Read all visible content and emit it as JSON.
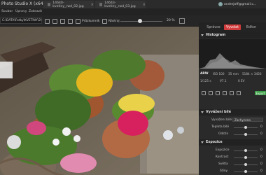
{
  "app": {
    "title": "Photo Studio X (x64)"
  },
  "tabs": [
    {
      "label": "14640-kvetiny_rwd_02.jpg"
    },
    {
      "label": "14643-kvetiny_rwd_03.jpg"
    }
  ],
  "user": {
    "email": "ondrejoff@gmail.c..."
  },
  "menu": [
    {
      "label": "Soubor"
    },
    {
      "label": "Úpravy"
    },
    {
      "label": "Zobrazit"
    }
  ],
  "toolbar": {
    "path": "C:\\DATA\\Fotky\\KVETINY\\2017",
    "browse_label": "Průzkumník",
    "new_label": "Nástroj",
    "zoom": "20 %"
  },
  "modes": [
    {
      "label": "Správce"
    },
    {
      "label": "Vyvolat"
    },
    {
      "label": "Editor"
    }
  ],
  "panel": {
    "histogram_title": "Histogram",
    "raw_label": "ARW",
    "iso": "ISO 100",
    "focal": "35 mm",
    "dims": "5184 × 3456",
    "shutter": "1/125 s",
    "aperture": "f/7.1",
    "exposure_bias": "0 EV",
    "ev_label": "",
    "green_label": "Export",
    "wb_title": "Vyvážení bílé",
    "wb_label": "Vyvážení bílé",
    "wb_value": "Zachyceno",
    "temp_label": "Teplota bílé",
    "temp_value": "0",
    "tint_label": "Odstín",
    "tint_value": "0",
    "exp_title": "Expozice",
    "exp_label": "Expozice",
    "contrast_label": "Kontrast",
    "light_label": "Světla",
    "shadow_label": "Stíny",
    "exp_value": "0",
    "contrast_value": "0",
    "light_value": "0",
    "shadow_value": "0"
  }
}
